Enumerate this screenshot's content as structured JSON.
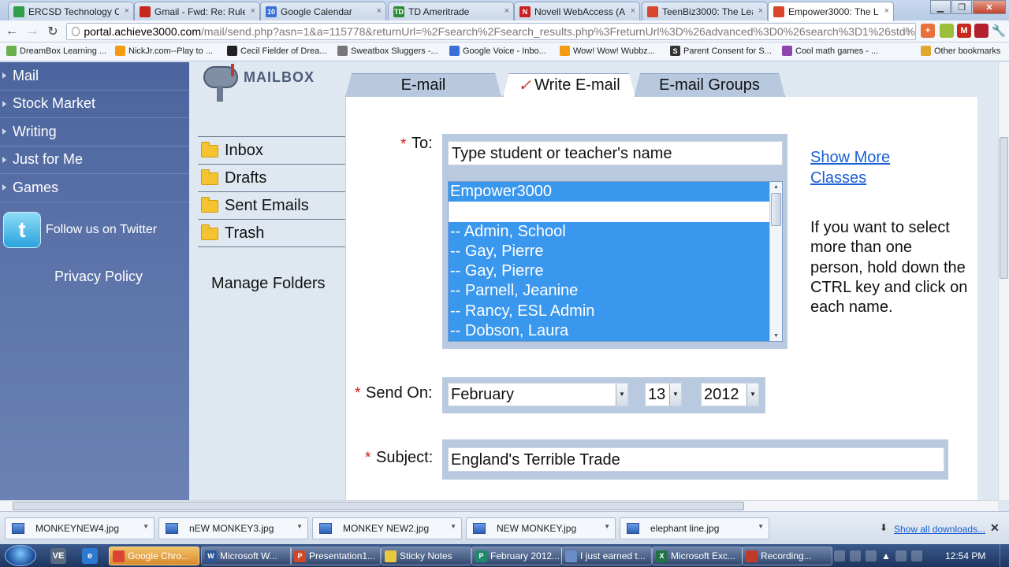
{
  "browser": {
    "tabs": [
      {
        "label": "ERCSD Technology Co",
        "icon": "green-square-icon",
        "color": "#2e9e4a"
      },
      {
        "label": "Gmail - Fwd: Re: Rules",
        "icon": "gmail-icon",
        "color": "#c5281c"
      },
      {
        "label": "Google Calendar",
        "icon": "calendar-icon",
        "color": "#3a6fd8",
        "badge": "10"
      },
      {
        "label": "TD Ameritrade",
        "icon": "td-icon",
        "color": "#2d8a35",
        "badge": "TD"
      },
      {
        "label": "Novell WebAccess (AN",
        "icon": "novell-icon",
        "color": "#cc1f1f",
        "badge": "N"
      },
      {
        "label": "TeenBiz3000: The Lead",
        "icon": "achieve-icon",
        "color": "#d9452c"
      },
      {
        "label": "Empower3000: The Lea",
        "icon": "achieve-icon",
        "color": "#d9452c",
        "active": true
      }
    ],
    "url_host": "portal.achieve3000.com",
    "url_path": "/mail/send.php?asn=1&a=115778&returnUrl=%2Fsearch%2Fsearch_results.php%3FreturnUrl%3D%26advanced%3D0%26search%3D1%26std%",
    "bookmarks": [
      {
        "label": "DreamBox Learning ...",
        "icon": "dreambox-icon",
        "color": "#6ab04c"
      },
      {
        "label": "NickJr.com--Play to ...",
        "icon": "nickjr-icon",
        "color": "#f39c12"
      },
      {
        "label": "Cecil Fielder of Drea...",
        "icon": "eye-icon",
        "color": "#222222"
      },
      {
        "label": "Sweatbox Sluggers -...",
        "icon": "globe-icon",
        "color": "#777777"
      },
      {
        "label": "Google Voice - Inbo...",
        "icon": "phone-icon",
        "color": "#3a6fd8"
      },
      {
        "label": "Wow! Wow! Wubbz...",
        "icon": "nickjr-icon",
        "color": "#f39c12"
      },
      {
        "label": "Parent Consent for S...",
        "icon": "s-icon",
        "color": "#333333",
        "badge": "S"
      },
      {
        "label": "Cool math games - ...",
        "icon": "coolmath-icon",
        "color": "#8e44ad"
      },
      {
        "label": "Other bookmarks",
        "icon": "folder-icon",
        "color": "#e0a82e"
      }
    ]
  },
  "sidebar": {
    "items": [
      {
        "label": "Mail"
      },
      {
        "label": "Stock Market"
      },
      {
        "label": "Writing"
      },
      {
        "label": "Just for Me"
      },
      {
        "label": "Games"
      }
    ],
    "twitter_label": "Follow us on Twitter",
    "privacy_label": "Privacy Policy"
  },
  "mailbox": {
    "title": "MAILBOX",
    "folders": [
      {
        "label": "Inbox"
      },
      {
        "label": "Drafts"
      },
      {
        "label": "Sent Emails"
      },
      {
        "label": "Trash"
      }
    ],
    "manage_label": "Manage Folders"
  },
  "tabs": [
    {
      "label": "E-mail"
    },
    {
      "label": "Write E-mail",
      "active": true
    },
    {
      "label": "E-mail Groups"
    }
  ],
  "form": {
    "to_label": "To:",
    "to_placeholder": "Type student or teacher's name",
    "recipients": [
      "Empower3000",
      "",
      "-- Admin, School",
      "-- Gay, Pierre",
      "-- Gay, Pierre",
      "-- Parnell, Jeanine",
      "-- Rancy, ESL Admin",
      "-- Dobson, Laura"
    ],
    "show_more": "Show More Classes",
    "help": "If you want to select more than one person, hold down the CTRL key and click on each name.",
    "send_on_label": "Send On:",
    "month": "February",
    "day": "13",
    "year": "2012",
    "subject_label": "Subject:",
    "subject_value": "England's Terrible Trade",
    "required_mark": "*"
  },
  "downloads": {
    "items": [
      {
        "label": "MONKEYNEW4.jpg"
      },
      {
        "label": "nEW MONKEY3.jpg"
      },
      {
        "label": "MONKEY NEW2.jpg"
      },
      {
        "label": "NEW MONKEY.jpg"
      },
      {
        "label": "elephant line.jpg"
      }
    ],
    "show_all": "Show all downloads..."
  },
  "taskbar": {
    "tasks": [
      {
        "label": "Google Chro...",
        "icon": "chrome-icon",
        "color": "#db4437",
        "active": true
      },
      {
        "label": "Microsoft W...",
        "icon": "word-icon",
        "color": "#2b579a",
        "badge": "W"
      },
      {
        "label": "Presentation1...",
        "icon": "powerpoint-icon",
        "color": "#d24726",
        "badge": "P"
      },
      {
        "label": "Sticky Notes",
        "icon": "sticky-notes-icon",
        "color": "#e8c840"
      },
      {
        "label": "February 2012...",
        "icon": "publisher-icon",
        "color": "#1e8a6c",
        "badge": "P"
      },
      {
        "label": "I just earned t...",
        "icon": "messenger-icon",
        "color": "#6a8cc7"
      },
      {
        "label": "Microsoft Exc...",
        "icon": "excel-icon",
        "color": "#217346",
        "badge": "X"
      },
      {
        "label": "Recording...",
        "icon": "record-icon",
        "color": "#c0392b"
      }
    ],
    "clock": "12:54 PM"
  }
}
